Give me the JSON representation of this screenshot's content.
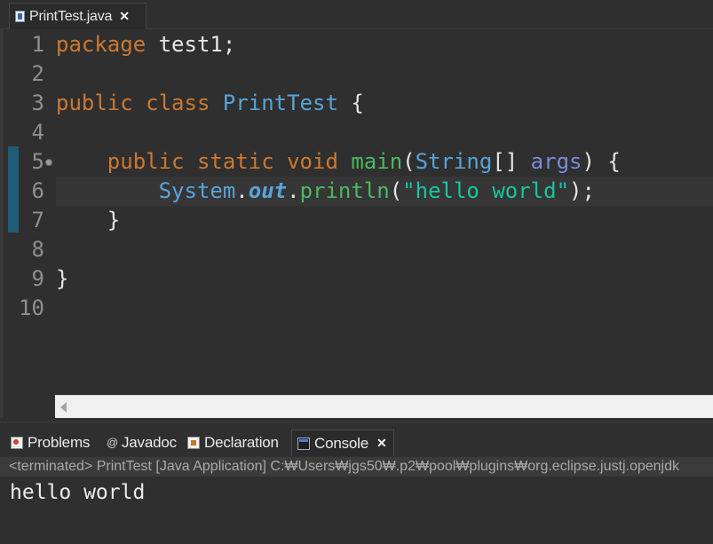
{
  "editor_tab": {
    "title": "PrintTest.java",
    "icon": "java-file-icon",
    "close_glyph": "✕"
  },
  "editor": {
    "current_line": 6,
    "lines": [
      {
        "n": "1",
        "tokens": [
          [
            "kw",
            "package"
          ],
          [
            "plain",
            " test1;"
          ]
        ]
      },
      {
        "n": "2",
        "tokens": []
      },
      {
        "n": "3",
        "tokens": [
          [
            "kw",
            "public"
          ],
          [
            "plain",
            " "
          ],
          [
            "kw",
            "class"
          ],
          [
            "plain",
            " "
          ],
          [
            "type",
            "PrintTest"
          ],
          [
            "plain",
            " {"
          ]
        ]
      },
      {
        "n": "4",
        "tokens": []
      },
      {
        "n": "5",
        "tokens": [
          [
            "plain",
            "    "
          ],
          [
            "kw",
            "public"
          ],
          [
            "plain",
            " "
          ],
          [
            "kw",
            "static"
          ],
          [
            "plain",
            " "
          ],
          [
            "kw",
            "void"
          ],
          [
            "plain",
            " "
          ],
          [
            "method",
            "main"
          ],
          [
            "plain",
            "("
          ],
          [
            "type",
            "String"
          ],
          [
            "plain",
            "[] "
          ],
          [
            "param",
            "args"
          ],
          [
            "plain",
            ") {"
          ]
        ],
        "fold": true
      },
      {
        "n": "6",
        "tokens": [
          [
            "plain",
            "        "
          ],
          [
            "type",
            "System"
          ],
          [
            "plain",
            "."
          ],
          [
            "field",
            "out"
          ],
          [
            "plain",
            "."
          ],
          [
            "method",
            "println"
          ],
          [
            "plain",
            "("
          ],
          [
            "str",
            "\"hello world\""
          ],
          [
            "plain",
            ");"
          ]
        ]
      },
      {
        "n": "7",
        "tokens": [
          [
            "plain",
            "    }"
          ]
        ]
      },
      {
        "n": "8",
        "tokens": []
      },
      {
        "n": "9",
        "tokens": [
          [
            "plain",
            "}"
          ]
        ]
      },
      {
        "n": "10",
        "tokens": []
      }
    ]
  },
  "panel_tabs": [
    {
      "label": "Problems",
      "icon": "problems-icon",
      "active": false
    },
    {
      "label": "Javadoc",
      "icon": "javadoc-icon",
      "active": false
    },
    {
      "label": "Declaration",
      "icon": "declaration-icon",
      "active": false
    },
    {
      "label": "Console",
      "icon": "console-icon",
      "active": true,
      "close_glyph": "✕"
    }
  ],
  "console": {
    "status": "<terminated> PrintTest [Java Application] C:₩Users₩jgs50₩.p2₩pool₩plugins₩org.eclipse.justj.openjdk",
    "output": "hello world"
  },
  "colors": {
    "background": "#2f2f2f",
    "keyword": "#cc7832",
    "type": "#58a3d8",
    "method": "#4cb860",
    "string": "#17c6a3",
    "parameter": "#7c8ad6"
  }
}
